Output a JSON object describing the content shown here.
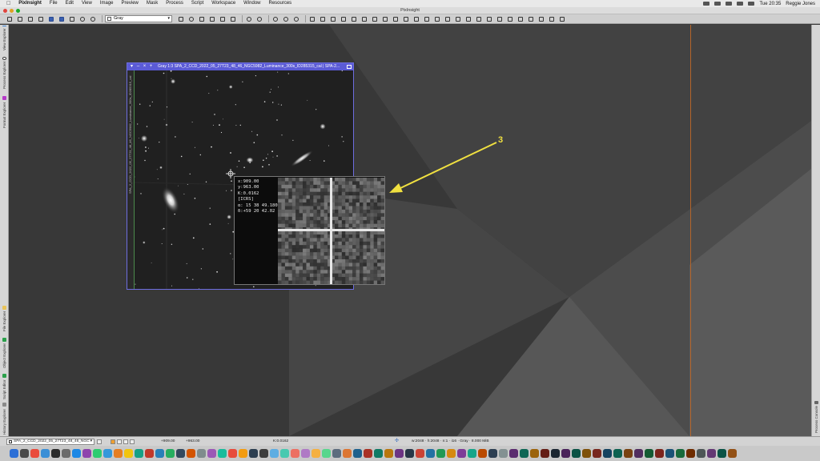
{
  "menubar": {
    "apple": "",
    "app_name": "PixInsight",
    "items": [
      "File",
      "Edit",
      "View",
      "Image",
      "Preview",
      "Mask",
      "Process",
      "Script",
      "Workspace",
      "Window",
      "Resources"
    ],
    "clock": "Tue 20:35",
    "user": "Reggie Jones"
  },
  "window_title": "PixInsight",
  "toolbar": {
    "colorspace_value": "Gray"
  },
  "side_tabs_left": [
    "View Explorer",
    "Process Explorer",
    "Format Explorer",
    "File Explorer",
    "Object Explorer",
    "Script Editor",
    "History Explorer"
  ],
  "side_tabs_right": [
    "Process Console"
  ],
  "image_window": {
    "title": "Gray 1:3 SPA_2_CCD_2022_05_27T23_48_46_NGC5982_Luminance_300s_ID285315_cal | SPA-2...",
    "side_label": "SPA_2_CCD_2022_05_27T23_48_46_NGC5982_Luminance_300s_ID285315_cal"
  },
  "readout": {
    "x": "x:909.00",
    "y": "y:963.00",
    "k": "K:0.0162",
    "system": "[ICRS]",
    "ra": "α: 15 38 49.180",
    "dec": "δ:+59 20 42.02"
  },
  "annotation": {
    "number": "3"
  },
  "statusbar": {
    "view_name": "SPA_2_CCD_2022_05_27T23_48_46_NGC",
    "x": "+909.00",
    "y": "+963.00",
    "k": "K:0.0162",
    "info": "w:2048 · h:2048 · n:1 · i16 · Gray · 8.000 MiB"
  },
  "colors": {
    "image_window_title": "#5b5bd6",
    "annotation": "#f0e040",
    "guide_line": "#b5652a"
  }
}
